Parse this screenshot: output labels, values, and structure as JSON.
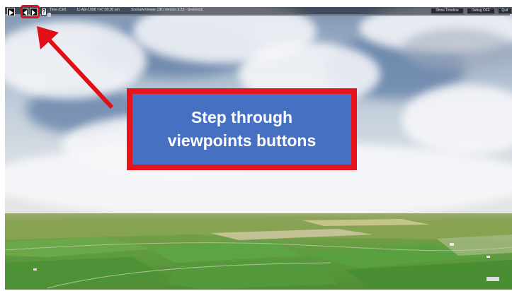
{
  "toolbar": {
    "buttons": [
      {
        "name": "play",
        "icon": "play-icon"
      },
      {
        "name": "step-back",
        "icon": "step-back-icon"
      },
      {
        "name": "step-forward",
        "icon": "step-forward-icon"
      }
    ],
    "help_label": "?",
    "time_label": "Time (Ctrl)",
    "datetime": "11-Apr-1998  7:47:00.00 am",
    "app_version": "ScenarioViewer (3D) Version 3.23 - Greenock",
    "show_timeline_label": "Show Timeline",
    "debug_label": "Debug OFF",
    "quit_label": "Quit"
  },
  "annotation": {
    "callout_line1": "Step through",
    "callout_line2": "viewpoints buttons",
    "color_red": "#e11018",
    "color_blue": "#4670c2"
  }
}
